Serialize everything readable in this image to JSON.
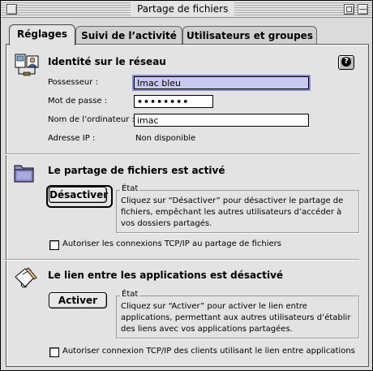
{
  "window": {
    "title": "Partage de fichiers"
  },
  "tabs": [
    {
      "label": "Réglages"
    },
    {
      "label": "Suivi de l’activité"
    },
    {
      "label": "Utilisateurs et groupes"
    }
  ],
  "identity": {
    "heading": "Identité sur le réseau",
    "owner_label": "Possesseur :",
    "owner_value": "Imac bleu",
    "password_label": "Mot de passe :",
    "password_value": "••••••••",
    "computer_label": "Nom de l’ordinateur :",
    "computer_value": "imac",
    "ip_label": "Adresse IP :",
    "ip_value": "Non disponible",
    "help_glyph": "?"
  },
  "file_sharing": {
    "heading": "Le partage de fichiers est activé",
    "button_label": "Désactiver",
    "status_legend": "État",
    "status_text": "Cliquez sur “Désactiver” pour désactiver le partage de fichiers, empêchant les autres utilisateurs d’accéder à vos dossiers partagés.",
    "tcp_checkbox_label": "Autoriser les connexions TCP/IP au partage de fichiers",
    "tcp_checked": false
  },
  "program_linking": {
    "heading": "Le lien entre les applications est désactivé",
    "button_label": "Activer",
    "status_legend": "État",
    "status_text": "Cliquez sur “Activer” pour activer le lien entre applications, permettant aux autres utilisateurs d’établir des liens avec vos applications partagées.",
    "tcp_checkbox_label": "Autoriser connexion TCP/IP des clients utilisant le lien entre applications",
    "tcp_checked": false
  },
  "icons": {
    "identity": "network-identity-icon",
    "folder": "shared-folder-icon",
    "linking": "program-linking-icon"
  }
}
